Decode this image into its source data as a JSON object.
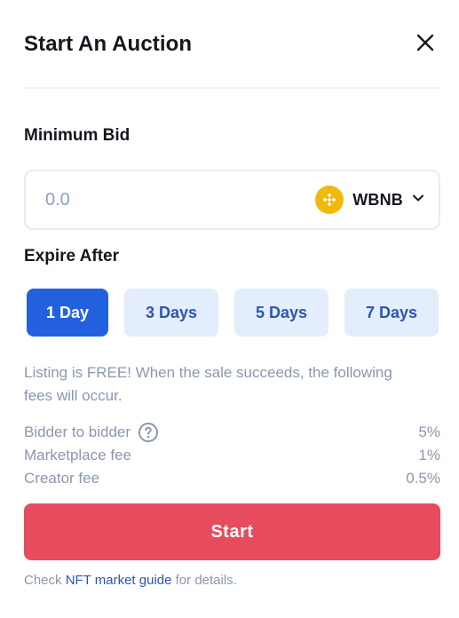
{
  "modal": {
    "title": "Start An Auction"
  },
  "minimum_bid": {
    "label": "Minimum Bid",
    "placeholder": "0.0",
    "value": "",
    "token": "WBNB"
  },
  "expire": {
    "label": "Expire After",
    "options": [
      "1 Day",
      "3 Days",
      "5 Days",
      "7 Days"
    ],
    "selected": "1 Day"
  },
  "info_text": "Listing is FREE! When the sale succeeds, the following fees will occur.",
  "fees": [
    {
      "label": "Bidder to bidder",
      "value": "5%"
    },
    {
      "label": "Marketplace fee",
      "value": "1%"
    },
    {
      "label": "Creator fee",
      "value": "0.5%"
    }
  ],
  "start_label": "Start",
  "footer": {
    "prefix": "Check",
    "link": "NFT market guide",
    "suffix": "for details."
  },
  "icons": {
    "close": "close-icon",
    "token": "bnb-icon",
    "dropdown": "chevron-down-icon",
    "help": "question-circle-icon"
  },
  "colors": {
    "accent": "#2260e0",
    "start_button": "#e74c5e",
    "token_icon": "#f0b90b",
    "inactive_day_bg": "#e4edfb"
  }
}
